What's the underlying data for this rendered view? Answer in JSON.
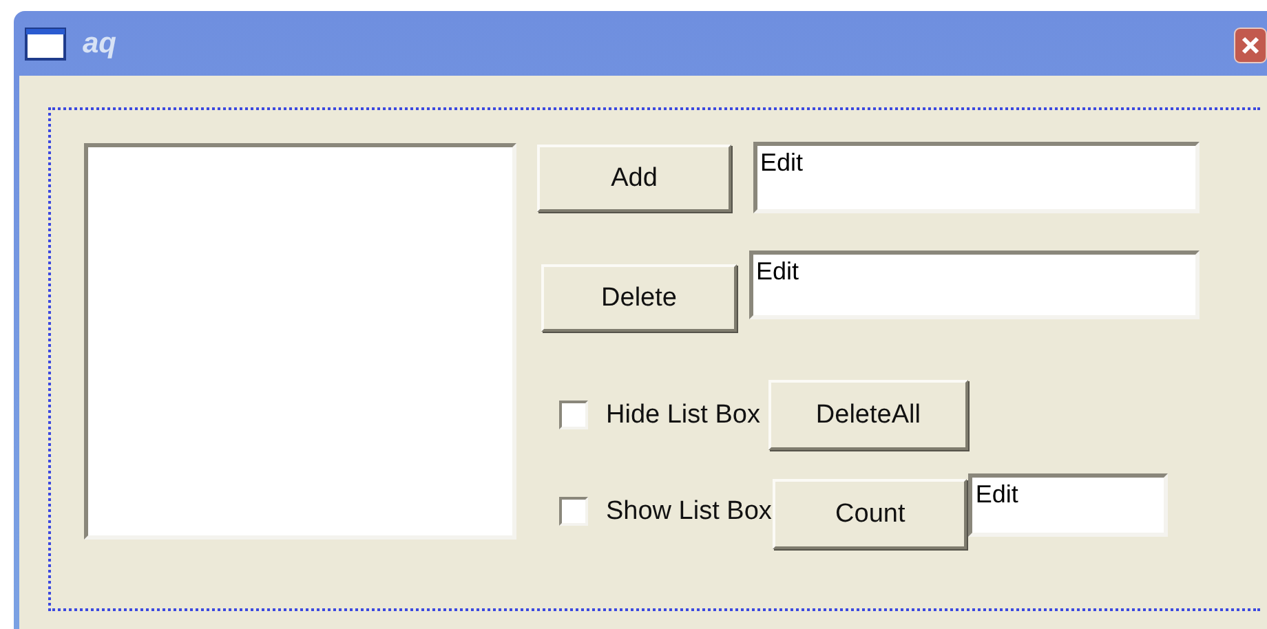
{
  "window": {
    "title": "aq"
  },
  "rows": [
    [
      {
        "kind": "button",
        "label": "Add"
      },
      {
        "kind": "edit",
        "value": "Edit"
      }
    ],
    [
      {
        "kind": "button",
        "label": "Delete"
      },
      {
        "kind": "edit",
        "value": "Edit"
      }
    ],
    [
      {
        "kind": "checkbox",
        "label": "Hide List Box",
        "checked": false
      },
      {
        "kind": "button",
        "label": "DeleteAll"
      }
    ],
    [
      {
        "kind": "checkbox",
        "label": "Show List Box",
        "checked": false
      },
      {
        "kind": "button",
        "label": "Count"
      },
      {
        "kind": "edit",
        "value": "Edit"
      }
    ]
  ]
}
